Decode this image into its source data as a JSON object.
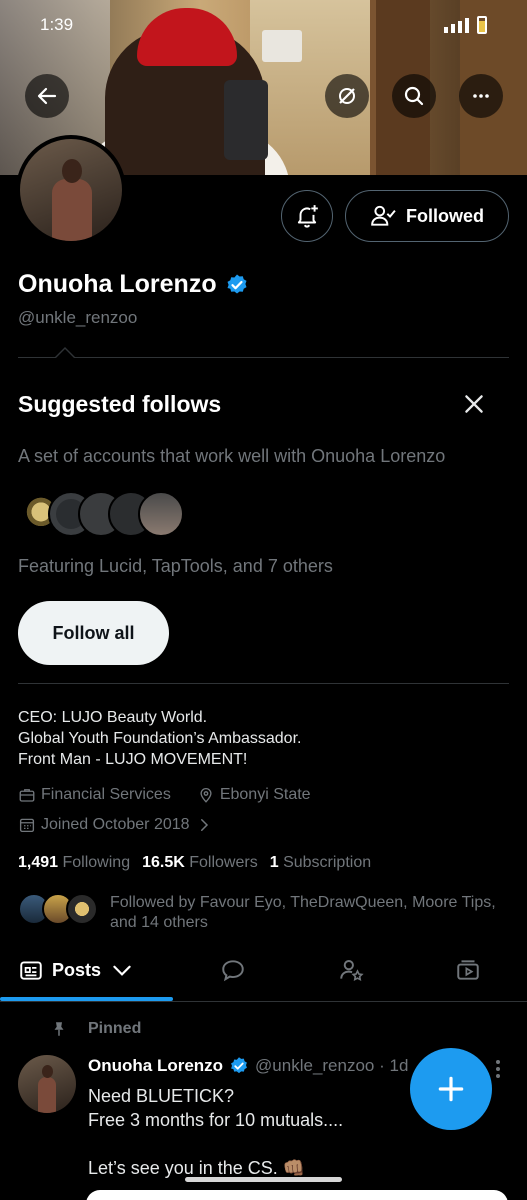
{
  "status_bar": {
    "time": "1:39"
  },
  "header_actions": {
    "back": "back-arrow-icon",
    "grok": "grok-icon",
    "search": "search-icon",
    "more": "more-icon"
  },
  "profile": {
    "name": "Onuoha Lorenzo",
    "handle": "@unkle_renzoo",
    "verified": true,
    "followed_label": "Followed",
    "bio": [
      "CEO: LUJO Beauty World.",
      "Global Youth Foundation’s Ambassador.",
      "Front Man - LUJO MOVEMENT!"
    ],
    "category": "Financial Services",
    "location": "Ebonyi State",
    "joined": "Joined October 2018",
    "following_count": "1,491",
    "following_label": "Following",
    "followers_count": "16.5K",
    "followers_label": "Followers",
    "subscription_count": "1",
    "subscription_label": "Subscription",
    "followed_by": "Followed by Favour Eyo, TheDrawQueen, Moore Tips, and 14 others"
  },
  "suggested": {
    "title": "Suggested follows",
    "description": "A set of accounts that work well with Onuoha Lorenzo",
    "featuring": "Featuring Lucid, TapTools, and 7 others",
    "follow_all": "Follow all"
  },
  "tabs": {
    "posts": "Posts"
  },
  "post": {
    "pinned": "Pinned",
    "name": "Onuoha Lorenzo",
    "handle": "@unkle_renzoo · 1d",
    "text": "Need BLUETICK?\nFree 3 months for 10 mutuals....\n\nLet’s see you in the CS. 👊🏽"
  },
  "colors": {
    "accent": "#1d9bf0",
    "background": "#000000",
    "muted": "#71767b"
  }
}
